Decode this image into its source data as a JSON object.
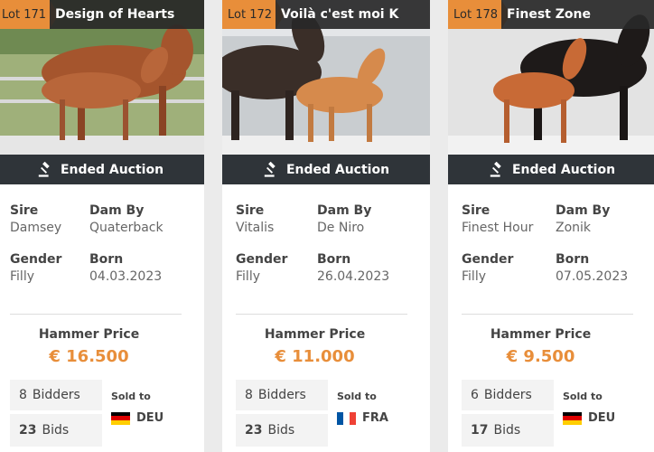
{
  "cards": [
    {
      "lot": "Lot 171",
      "title": "Design of Hearts",
      "status": "Ended Auction",
      "sire_label": "Sire",
      "sire": "Damsey",
      "dam_label": "Dam By",
      "dam": "Quaterback",
      "gender_label": "Gender",
      "gender": "Filly",
      "born_label": "Born",
      "born": "04.03.2023",
      "hammer_label": "Hammer Price",
      "hammer_price": "€ 16.500",
      "bidders_count": "8",
      "bidders_label": "Bidders",
      "bids_count": "23",
      "bids_label": "Bids",
      "sold_to_label": "Sold to",
      "country": "DEU",
      "flag_colors": [
        "#000000",
        "#dd0000",
        "#ffce00"
      ]
    },
    {
      "lot": "Lot 172",
      "title": "Voilà c'est moi K",
      "status": "Ended Auction",
      "sire_label": "Sire",
      "sire": "Vitalis",
      "dam_label": "Dam By",
      "dam": "De Niro",
      "gender_label": "Gender",
      "gender": "Filly",
      "born_label": "Born",
      "born": "26.04.2023",
      "hammer_label": "Hammer Price",
      "hammer_price": "€ 11.000",
      "bidders_count": "8",
      "bidders_label": "Bidders",
      "bids_count": "23",
      "bids_label": "Bids",
      "sold_to_label": "Sold to",
      "country": "FRA",
      "flag_colors": [
        "#0055a4",
        "#ffffff",
        "#ef4135"
      ]
    },
    {
      "lot": "Lot 178",
      "title": "Finest Zone",
      "status": "Ended Auction",
      "sire_label": "Sire",
      "sire": "Finest Hour",
      "dam_label": "Dam By",
      "dam": "Zonik",
      "gender_label": "Gender",
      "gender": "Filly",
      "born_label": "Born",
      "born": "07.05.2023",
      "hammer_label": "Hammer Price",
      "hammer_price": "€ 9.500",
      "bidders_count": "6",
      "bidders_label": "Bidders",
      "bids_count": "17",
      "bids_label": "Bids",
      "sold_to_label": "Sold to",
      "country": "DEU",
      "flag_colors": [
        "#000000",
        "#dd0000",
        "#ffce00"
      ]
    }
  ],
  "colors": {
    "accent": "#e88e3a",
    "status_bar": "#2f3439"
  }
}
